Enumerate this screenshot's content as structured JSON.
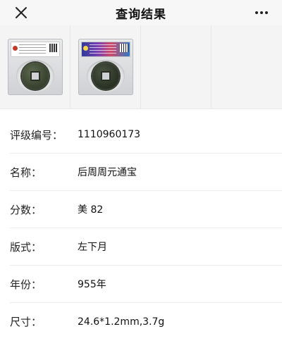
{
  "navbar": {
    "title": "查询结果",
    "close_icon": "close-icon",
    "more_icon": "more-icon"
  },
  "images": [
    {
      "label": "coin slab front"
    },
    {
      "label": "coin slab back"
    }
  ],
  "details": [
    {
      "label": "评级编号：",
      "value": "1110960173"
    },
    {
      "label": "名称：",
      "value": "后周周元通宝"
    },
    {
      "label": "分数：",
      "value": "美 82"
    },
    {
      "label": "版式：",
      "value": "左下月"
    },
    {
      "label": "年份：",
      "value": "955年"
    },
    {
      "label": "尺寸：",
      "value": "24.6*1.2mm,3.7g"
    }
  ]
}
